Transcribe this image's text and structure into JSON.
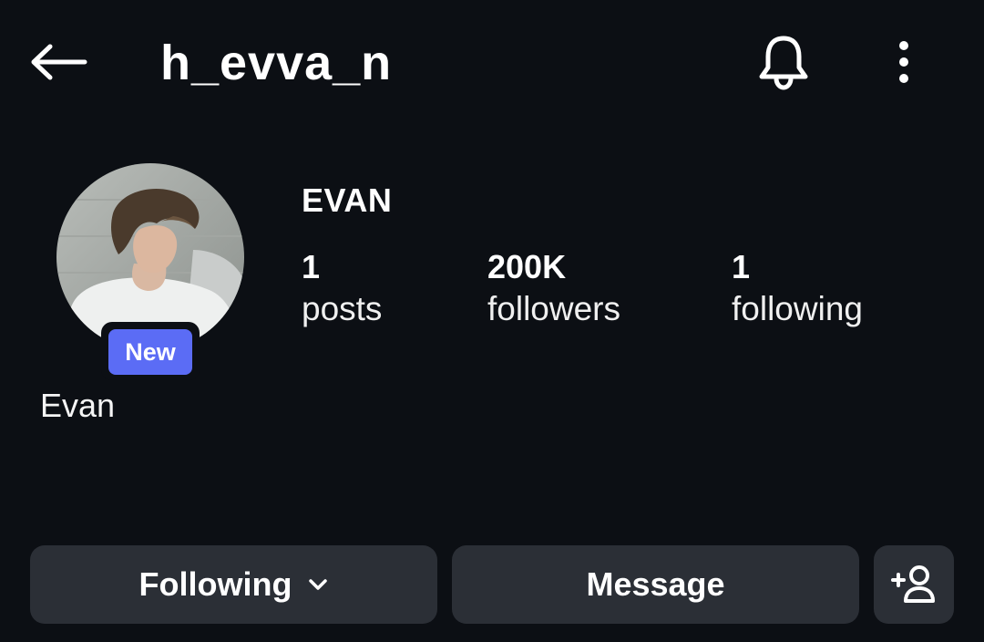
{
  "header": {
    "username": "h_evva_n",
    "back_icon": "arrow-left-icon",
    "bell_icon": "bell-icon",
    "more_icon": "more-vertical-icon"
  },
  "profile": {
    "avatar_badge": "New",
    "display_name": "Evan",
    "full_name": "EVAN",
    "stats": {
      "posts": {
        "value": "1",
        "label": "posts"
      },
      "followers": {
        "value": "200K",
        "label": "followers"
      },
      "following": {
        "value": "1",
        "label": "following"
      }
    }
  },
  "actions": {
    "following_label": "Following",
    "message_label": "Message",
    "add_user_icon": "add-user-icon"
  },
  "colors": {
    "background": "#0c0f14",
    "button_bg": "#2b2f36",
    "badge_bg": "#5b6cf5",
    "text": "#ffffff"
  }
}
